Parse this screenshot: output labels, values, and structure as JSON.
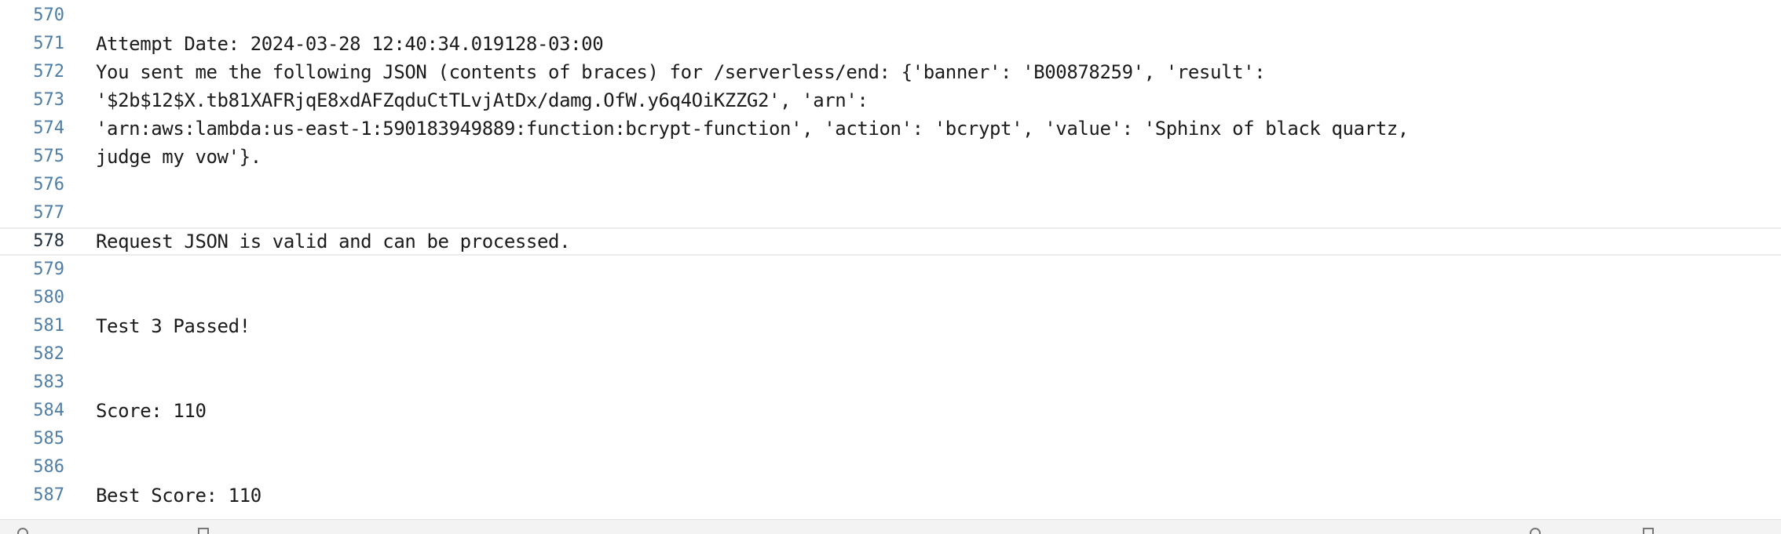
{
  "editor": {
    "lines": [
      {
        "num": "570",
        "text": ""
      },
      {
        "num": "571",
        "text": "Attempt Date: 2024-03-28 12:40:34.019128-03:00"
      },
      {
        "num": "572",
        "text": "You sent me the following JSON (contents of braces) for /serverless/end: {'banner': 'B00878259', 'result':"
      },
      {
        "num": "573",
        "text": "'$2b$12$X.tb81XAFRjqE8xdAFZqduCtTLvjAtDx/damg.OfW.y6q4OiKZZG2', 'arn':"
      },
      {
        "num": "574",
        "text": "'arn:aws:lambda:us-east-1:590183949889:function:bcrypt-function', 'action': 'bcrypt', 'value': 'Sphinx of black quartz,"
      },
      {
        "num": "575",
        "text": "judge my vow'}."
      },
      {
        "num": "576",
        "text": ""
      },
      {
        "num": "577",
        "text": ""
      },
      {
        "num": "578",
        "text": "Request JSON is valid and can be processed."
      },
      {
        "num": "579",
        "text": ""
      },
      {
        "num": "580",
        "text": ""
      },
      {
        "num": "581",
        "text": "Test 3 Passed!"
      },
      {
        "num": "582",
        "text": ""
      },
      {
        "num": "583",
        "text": ""
      },
      {
        "num": "584",
        "text": "Score: 110"
      },
      {
        "num": "585",
        "text": ""
      },
      {
        "num": "586",
        "text": ""
      },
      {
        "num": "587",
        "text": "Best Score: 110"
      }
    ],
    "current_line": "578"
  },
  "statusbar": {
    "icons": [
      "status-circle-icon",
      "panel-toggle-icon",
      "sync-icon",
      "layout-icon"
    ]
  }
}
